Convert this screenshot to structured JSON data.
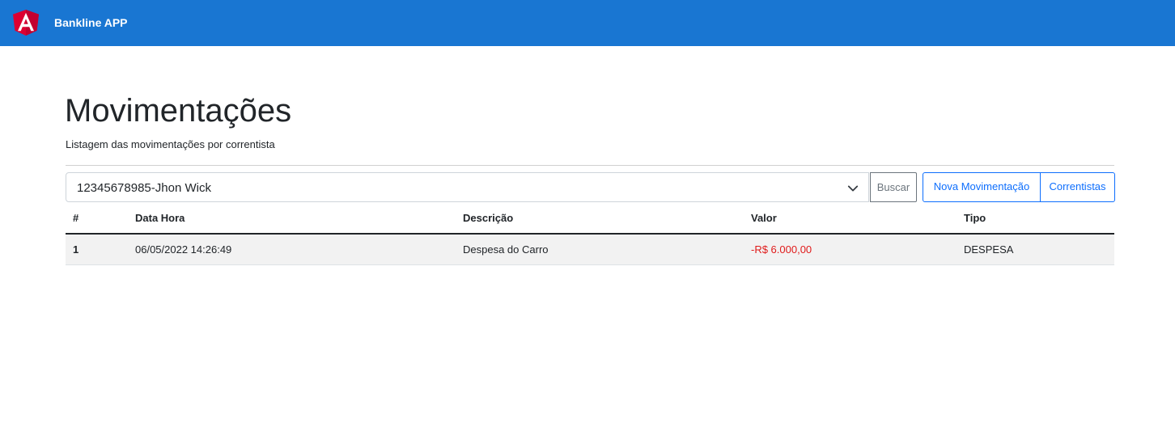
{
  "header": {
    "app_title": "Bankline APP",
    "logo_icon": "angular-logo-icon",
    "bg_color": "#1976d2"
  },
  "page": {
    "title": "Movimentações",
    "subtitle": "Listagem das movimentações por correntista"
  },
  "filter": {
    "selected": "12345678985-Jhon Wick",
    "search_label": "Buscar"
  },
  "actions": {
    "new_label": "Nova Movimentação",
    "holders_label": "Correntistas"
  },
  "table": {
    "headers": [
      "#",
      "Data Hora",
      "Descrição",
      "Valor",
      "Tipo"
    ],
    "rows": [
      {
        "id": "1",
        "datetime": "06/05/2022 14:26:49",
        "description": "Despesa do Carro",
        "value": "-R$ 6.000,00",
        "type": "DESPESA"
      }
    ]
  },
  "colors": {
    "negative_value": "#e01b1b",
    "primary": "#0d6efd"
  }
}
